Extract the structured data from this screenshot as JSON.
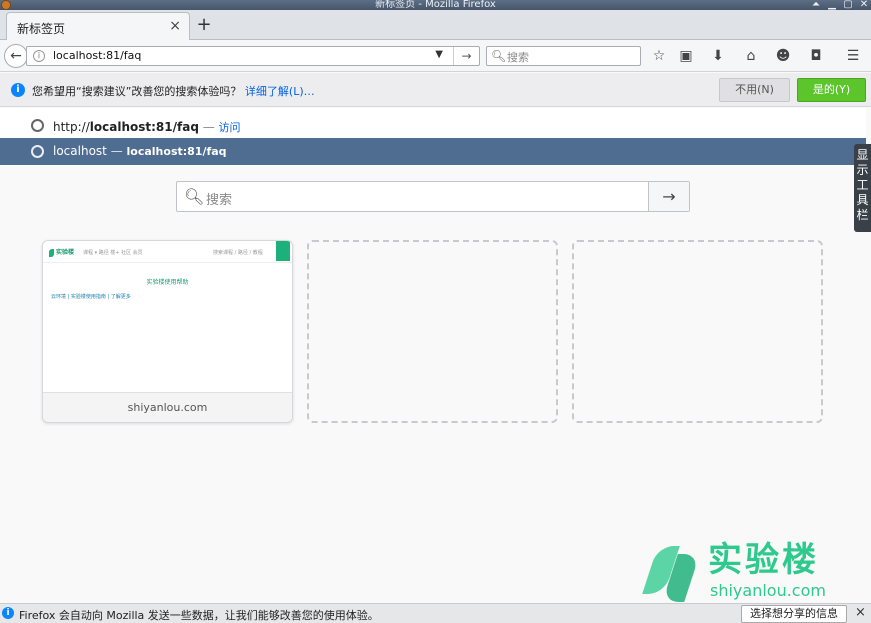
{
  "window": {
    "title": "新标签页 - Mozilla Firefox",
    "controls": [
      "⏶",
      "▁",
      "▢",
      "✕"
    ]
  },
  "tabs": [
    {
      "title": "新标签页",
      "close": "×"
    }
  ],
  "new_tab_button": "+",
  "navbar": {
    "back": "←",
    "url": "localhost:81/faq",
    "dropdown": "▼",
    "go": "→",
    "search_placeholder": "搜索",
    "toolbar_icons": [
      "bookmark-star-icon",
      "reading-list-icon",
      "downloads-icon",
      "home-icon",
      "chat-icon",
      "pocket-icon",
      "menu-icon"
    ]
  },
  "notification": {
    "text": "您希望用“搜索建议”改善您的搜索体验吗？",
    "link": "详细了解(L)…",
    "no_button": "不用(N)",
    "yes_button": "是的(Y)"
  },
  "url_results": [
    {
      "prefix": "http://",
      "bold": "localhost:81/faq",
      "separator": " — ",
      "action": "访问"
    },
    {
      "title": "localhost",
      "separator": " — ",
      "url": "localhost:81/faq"
    }
  ],
  "side_toolbar_tag": "显示工具栏",
  "newtab": {
    "search_placeholder": "搜索",
    "search_go": "→",
    "tiles": [
      {
        "label": "shiyanlou.com",
        "thumb": {
          "logo": "实验楼",
          "links": "课程 ▾   路径   楼+   社区   会员",
          "search": "搜索课程 / 路径 / 教程",
          "login": "登录",
          "title": "实验楼使用帮助",
          "line": "云环境 | 实验楼使用指南 | 了解更多"
        }
      },
      {
        "label": ""
      },
      {
        "label": ""
      }
    ]
  },
  "watermark": {
    "title": "实验楼",
    "subtitle": "shiyanlou.com"
  },
  "bottom_notification": {
    "text": "Firefox 会自动向 Mozilla 发送一些数据，让我们能够改善您的使用体验。",
    "button": "选择想分享的信息(C)",
    "close": "×"
  },
  "colors": {
    "accent_blue": "#0a84ff",
    "yes_green": "#5bc52b",
    "selected_row": "#4f6c91",
    "brand_green": "#2ec98c"
  }
}
